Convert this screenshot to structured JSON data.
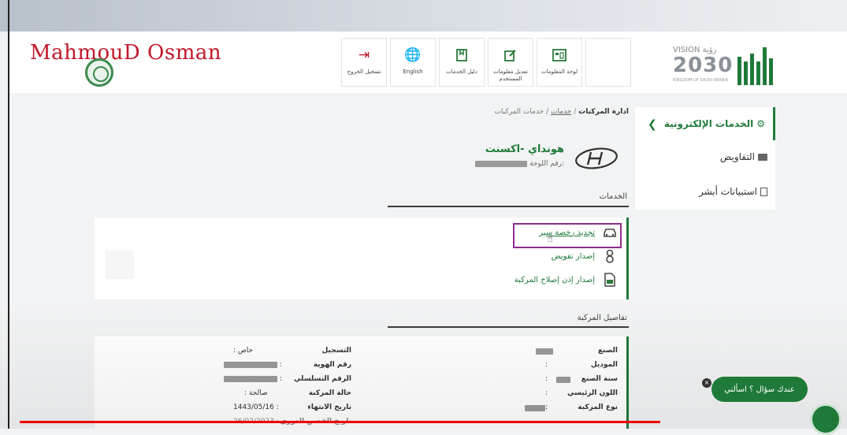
{
  "watermark": "MahmouD Osman",
  "header": {
    "tiles": [
      {
        "icon": "logout-icon",
        "label": "تسجيل الخروج"
      },
      {
        "icon": "globe-icon",
        "label": "English"
      },
      {
        "icon": "book-icon",
        "label": "دليل الخدمات"
      },
      {
        "icon": "edit-icon",
        "label": "تعديل معلومات المستخدم"
      },
      {
        "icon": "dashboard-icon",
        "label": "لوحة المعلومات"
      }
    ],
    "vision_label": "VISION رؤية",
    "vision_year": "2030",
    "vision_sub": "KINGDOM OF SAUDI ARABIA"
  },
  "sidebar": {
    "items": [
      {
        "label": "الخدمات الإلكترونية",
        "icon": "gear-icon"
      },
      {
        "label": "التفاويض",
        "icon": "briefcase-icon"
      },
      {
        "label": "استبيانات أبشر",
        "icon": "clipboard-icon"
      }
    ]
  },
  "breadcrumb": {
    "part1": "خدمات المركبات",
    "sep": "/",
    "part2": "خدمات",
    "part3": "ادارة المركبات"
  },
  "vehicle": {
    "name": "هونداي -اكسنت",
    "plate_label": "رقم اللوحة:"
  },
  "services": {
    "title": "الخدمات",
    "items": [
      {
        "label": "تجديد رخصة سير",
        "icon": "car-icon"
      },
      {
        "label": "إصدار تفويض",
        "icon": "user-icon"
      },
      {
        "label": "إصدار إذن إصلاح المركبة",
        "icon": "document-icon"
      }
    ]
  },
  "details": {
    "title": "تفاصيل المركبة",
    "right": [
      {
        "label": "الصنع",
        "value": ""
      },
      {
        "label": "الموديل",
        "value": ""
      },
      {
        "label": "سنة الصنع",
        "value": ""
      },
      {
        "label": "اللون الرئيسي",
        "value": ""
      },
      {
        "label": "نوع المركبة",
        "value": ""
      }
    ],
    "left": [
      {
        "label": "التسجيل",
        "value": "خاص"
      },
      {
        "label": "رقم الهوية",
        "value": ""
      },
      {
        "label": "الرقم التسلسلي",
        "value": ""
      },
      {
        "label": "حالة المركبة",
        "value": "صالحة"
      },
      {
        "label": "تاريخ الانتهاء",
        "value": "1443/05/16"
      },
      {
        "label": "تاريخ الفحص الدوري",
        "value": "26/02/2023"
      }
    ]
  },
  "chat": {
    "label": "عندك سؤال ؟ اسألني",
    "close": "×"
  },
  "colors": {
    "accent": "#1f7a3a",
    "highlight": "#8e2d8e",
    "progress": "#ee0000"
  }
}
